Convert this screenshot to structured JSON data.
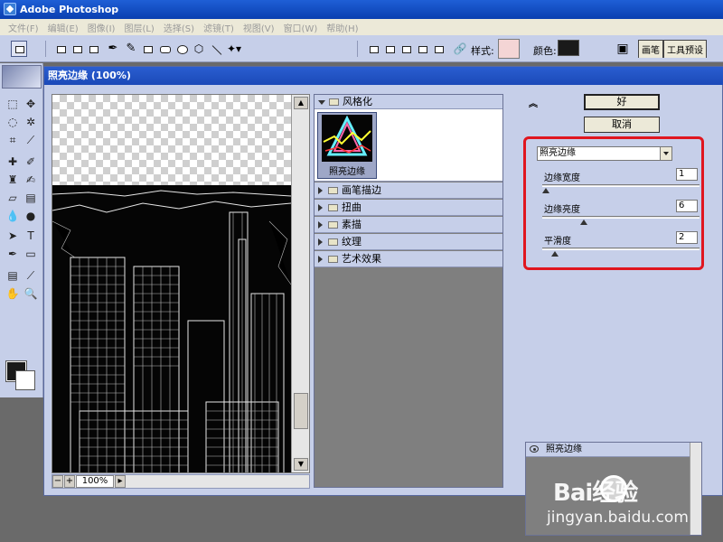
{
  "app": {
    "title": "Adobe Photoshop"
  },
  "menubar": {
    "items": [
      "文件(F)",
      "编辑(E)",
      "图像(I)",
      "图层(L)",
      "选择(S)",
      "滤镜(T)",
      "视图(V)",
      "窗口(W)",
      "帮助(H)"
    ]
  },
  "options": {
    "style_label": "样式:",
    "color_label": "颜色:",
    "palette_tabs": [
      "画笔",
      "工具预设"
    ],
    "color_value": "#1a1a1a",
    "style_value": "#f4d5d5"
  },
  "dialog": {
    "title": "照亮边缘 (100%)",
    "zoom": "100%",
    "ok_label": "好",
    "cancel_label": "取消"
  },
  "gallery": {
    "open_category": "风格化",
    "thumbnail_label": "照亮边缘",
    "categories": [
      "画笔描边",
      "扭曲",
      "素描",
      "纹理",
      "艺术效果"
    ]
  },
  "settings": {
    "filter": "照亮边缘",
    "params": [
      {
        "label": "边缘宽度",
        "value": "1",
        "fraction": 0.0
      },
      {
        "label": "边缘亮度",
        "value": "6",
        "fraction": 0.25
      },
      {
        "label": "平滑度",
        "value": "2",
        "fraction": 0.06
      }
    ]
  },
  "layers": {
    "items": [
      "照亮边缘"
    ]
  },
  "watermark": {
    "main": "Bai经验",
    "sub": "jingyan.baidu.com"
  }
}
